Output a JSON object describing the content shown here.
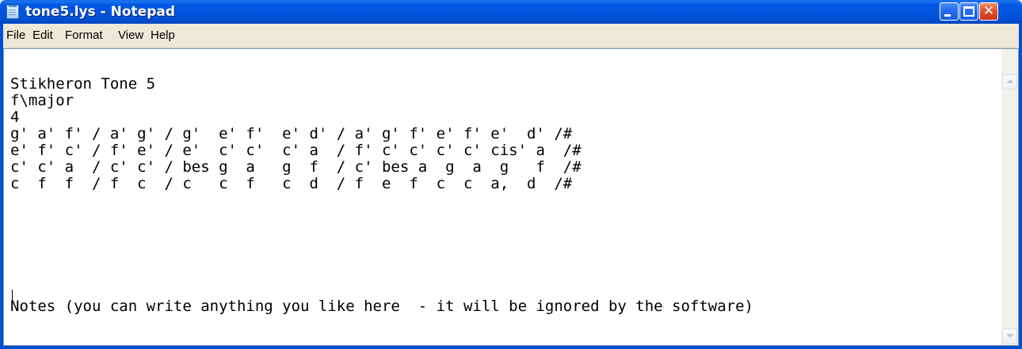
{
  "window": {
    "title": "tone5.lys - Notepad",
    "icon": "notepad-icon",
    "buttons": {
      "minimize": "minimize-icon",
      "maximize": "maximize-icon",
      "close": "close-icon",
      "close_glyph": "✕"
    }
  },
  "menu": {
    "items": [
      "File",
      "Edit",
      "Format",
      "View",
      "Help"
    ]
  },
  "editor": {
    "lines": [
      "Stikheron Tone 5",
      "f\\major",
      "4",
      "g' a' f' / a' g' / g'  e' f'  e' d' / a' g' f' e' f' e'  d' /#",
      "e' f' c' / f' e' / e'  c' c'  c' a  / f' c' c' c' c' cis' a  /#",
      "c' c' a  / c' c' / bes g  a   g  f  / c' bes a  g  a  g   f  /#",
      "c  f  f  / f  c  / c   c  f   c  d  / f  e  f  c  c  a,  d  /#",
      "",
      "",
      "",
      "",
      "Notes (you can write anything you like here  - it will be ignored by the software)"
    ]
  },
  "colors": {
    "titlebar": "#0055de",
    "close_button": "#e4572e",
    "menubar_bg": "#ece9d8",
    "editor_bg": "#ffffff"
  }
}
